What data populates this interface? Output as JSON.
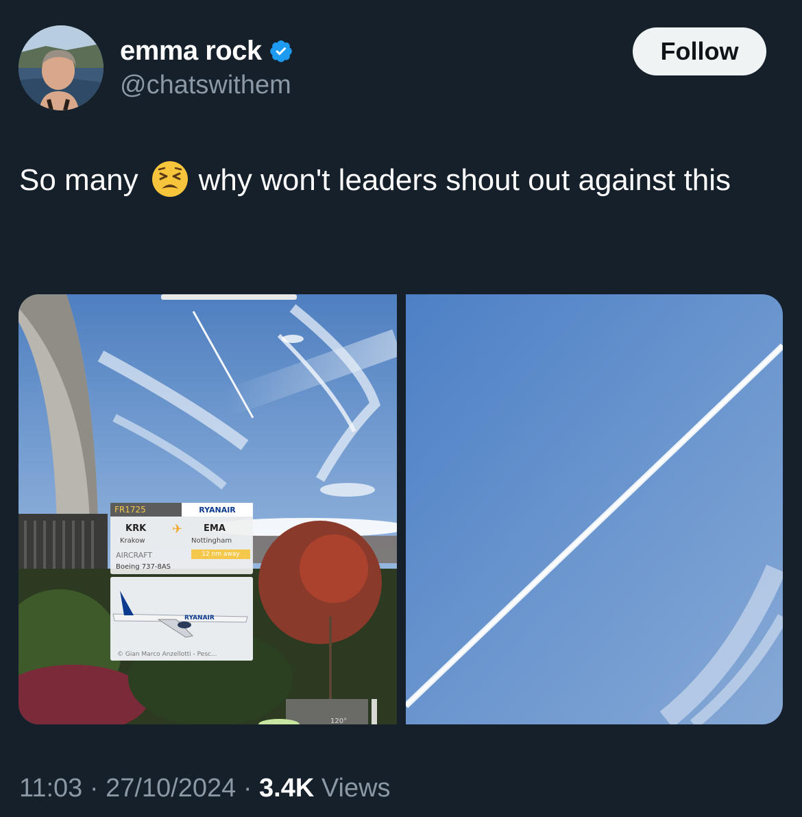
{
  "author": {
    "display_name": "emma rock",
    "handle": "@chatswithem",
    "verified": true
  },
  "follow_button": {
    "label": "Follow"
  },
  "tweet": {
    "text_before_emoji": "So many",
    "emoji": "tired-face",
    "text_after_emoji": "why won't leaders shout out against this"
  },
  "media": {
    "flight_card": {
      "flight": "FR1725",
      "airline": "RYANAIR",
      "from_code": "KRK",
      "from_city": "Krakow",
      "to_code": "EMA",
      "to_city": "Nottingham",
      "aircraft_label": "AIRCRAFT",
      "aircraft_type": "Boeing 737-8AS",
      "distance": "12 nm away",
      "photo_credit": "© Gian Marco Anzellotti - Pesc..."
    },
    "plane_livery": "RYANAIR"
  },
  "meta": {
    "time": "11:03",
    "date": "27/10/2024",
    "views_count": "3.4K",
    "views_label": "Views",
    "separator": "·"
  },
  "colors": {
    "background": "#15202b",
    "text_primary": "#ffffff",
    "text_secondary": "#8b98a5",
    "verified_blue": "#1d9bf0",
    "button_bg": "#eff3f4"
  }
}
